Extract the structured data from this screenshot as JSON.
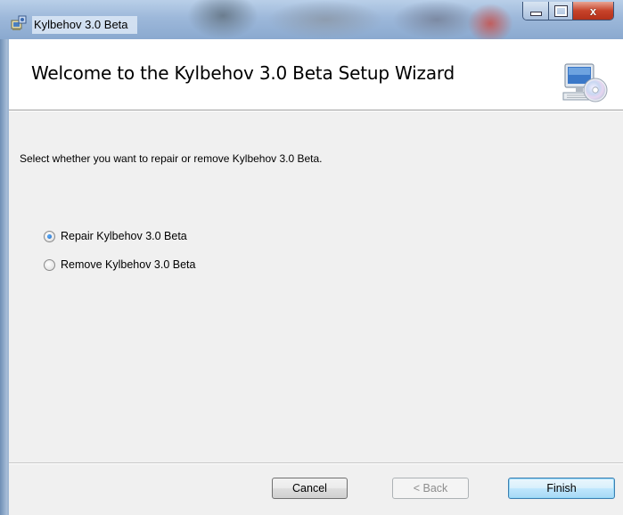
{
  "window": {
    "title": "Kylbehov 3.0 Beta",
    "caption_buttons": {
      "minimize": "minimize",
      "maximize": "maximize",
      "close": "x"
    }
  },
  "banner": {
    "title": "Welcome to the Kylbehov 3.0 Beta Setup Wizard",
    "icon": "computer-cd-icon"
  },
  "body": {
    "instruction": "Select whether you want to repair or remove Kylbehov 3.0 Beta.",
    "options": [
      {
        "label": "Repair Kylbehov 3.0 Beta",
        "selected": true
      },
      {
        "label": "Remove Kylbehov 3.0 Beta",
        "selected": false
      }
    ]
  },
  "footer": {
    "cancel_label": "Cancel",
    "back_label": "< Back",
    "finish_label": "Finish"
  },
  "colors": {
    "titlebar": "#9db8da",
    "client_bg": "#f0f0f0",
    "close_button": "#c7432a",
    "default_button": "#3c7fb1"
  }
}
